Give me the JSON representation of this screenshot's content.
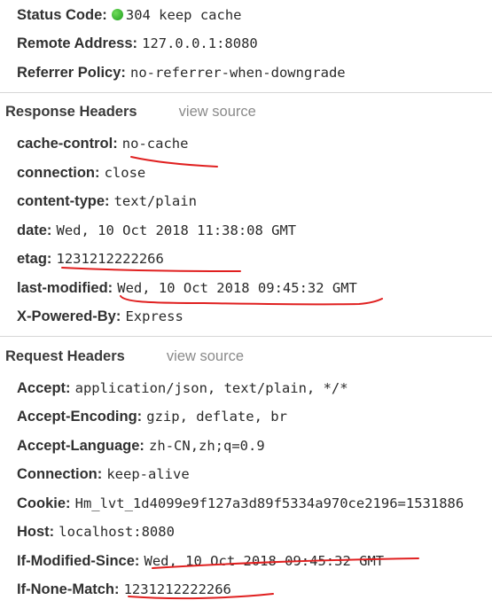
{
  "general": {
    "status_code_key": "Status Code:",
    "status_code_value": "304 keep cache",
    "status_color": "#1e9e1e",
    "remote_address_key": "Remote Address:",
    "remote_address_value": "127.0.0.1:8080",
    "referrer_policy_key": "Referrer Policy:",
    "referrer_policy_value": "no-referrer-when-downgrade"
  },
  "response_headers": {
    "title": "Response Headers",
    "view_source": "view source",
    "items": [
      {
        "key": "cache-control:",
        "value": "no-cache"
      },
      {
        "key": "connection:",
        "value": "close"
      },
      {
        "key": "content-type:",
        "value": "text/plain"
      },
      {
        "key": "date:",
        "value": "Wed, 10 Oct 2018 11:38:08 GMT"
      },
      {
        "key": "etag:",
        "value": "1231212222266"
      },
      {
        "key": "last-modified:",
        "value": "Wed, 10 Oct 2018 09:45:32 GMT"
      },
      {
        "key": "X-Powered-By:",
        "value": "Express"
      }
    ]
  },
  "request_headers": {
    "title": "Request Headers",
    "view_source": "view source",
    "items": [
      {
        "key": "Accept:",
        "value": "application/json, text/plain, */*"
      },
      {
        "key": "Accept-Encoding:",
        "value": "gzip, deflate, br"
      },
      {
        "key": "Accept-Language:",
        "value": "zh-CN,zh;q=0.9"
      },
      {
        "key": "Connection:",
        "value": "keep-alive"
      },
      {
        "key": "Cookie:",
        "value": "Hm_lvt_1d4099e9f127a3d89f5334a970ce2196=1531886"
      },
      {
        "key": "Host:",
        "value": "localhost:8080"
      },
      {
        "key": "If-Modified-Since:",
        "value": "Wed, 10 Oct 2018 09:45:32 GMT"
      },
      {
        "key": "If-None-Match:",
        "value": "1231212222266"
      }
    ]
  },
  "annotation_color": "#e02020"
}
